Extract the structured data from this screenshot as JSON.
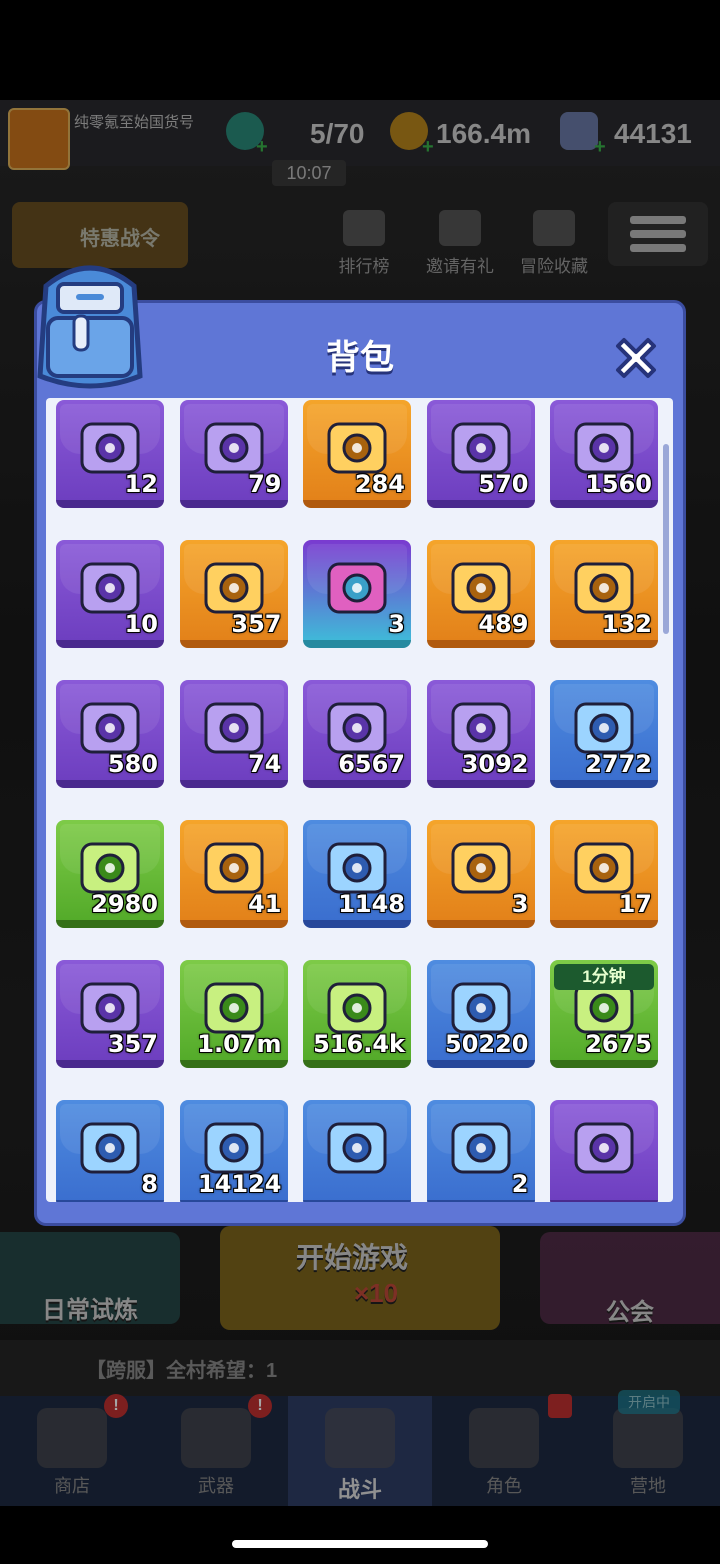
{
  "topbar": {
    "player_name": "纯零氪至始国货号",
    "stamina": "5/70",
    "gold": "166.4m",
    "gems": "44131",
    "timer": "10:07"
  },
  "top_actions": {
    "battle_pass": "特惠战令",
    "leaderboard": "排行榜",
    "invite": "邀请有礼",
    "collection": "冒险收藏"
  },
  "panel": {
    "title": "背包",
    "rows": [
      [
        {
          "icon": "green-ticket-icon",
          "rarity": "purple",
          "count": "12"
        },
        {
          "icon": "purple-gear-chest-icon",
          "rarity": "purple",
          "count": "79"
        },
        {
          "icon": "gold-ticket-icon",
          "rarity": "orange",
          "count": "284"
        },
        {
          "icon": "trophy-medal-icon",
          "rarity": "purple",
          "count": "570"
        },
        {
          "icon": "handshake-badge-icon",
          "rarity": "purple",
          "count": "1560"
        }
      ],
      [
        {
          "icon": "vortex-ticket-icon",
          "rarity": "purple",
          "count": "10"
        },
        {
          "icon": "robot-ticket-icon",
          "rarity": "orange",
          "count": "357"
        },
        {
          "icon": "vr-headset-icon",
          "rarity": "special",
          "count": "3"
        },
        {
          "icon": "cyan-screen-icon",
          "rarity": "orange",
          "count": "489"
        },
        {
          "icon": "gold-key-icon",
          "rarity": "orange",
          "count": "132"
        }
      ],
      [
        {
          "icon": "chip-tablet-icon",
          "rarity": "purple",
          "count": "580"
        },
        {
          "icon": "dark-dice-icon",
          "rarity": "purple",
          "count": "74"
        },
        {
          "icon": "purple-crystal-icon",
          "rarity": "purple",
          "count": "6567"
        },
        {
          "icon": "blue-card-icon",
          "rarity": "purple",
          "count": "3092"
        },
        {
          "icon": "blue-crystal-icon",
          "rarity": "blue",
          "count": "2772"
        }
      ],
      [
        {
          "icon": "green-gear-chest-icon",
          "rarity": "green",
          "count": "2980"
        },
        {
          "icon": "blue-arrow-triangle-icon",
          "rarity": "orange",
          "count": "41"
        },
        {
          "icon": "blue-gear-chest-icon",
          "rarity": "blue",
          "count": "1148"
        },
        {
          "icon": "gold-chest-icon",
          "rarity": "orange",
          "count": "3"
        },
        {
          "icon": "gold-arrow-coin-icon",
          "rarity": "orange",
          "count": "17"
        }
      ],
      [
        {
          "icon": "cyan-ticket-icon",
          "rarity": "purple",
          "count": "357"
        },
        {
          "icon": "energy-orb-icon",
          "rarity": "green",
          "count": "1.07m"
        },
        {
          "icon": "steel-beam-icon",
          "rarity": "green",
          "count": "516.4k"
        },
        {
          "icon": "sun-badge-icon",
          "rarity": "blue",
          "count": "50220"
        },
        {
          "icon": "fast-forward-icon",
          "rarity": "green",
          "count": "2675",
          "tag": "1分钟"
        }
      ],
      [
        {
          "icon": "hex-core-icon",
          "rarity": "blue",
          "count": "8"
        },
        {
          "icon": "chip-card-icon",
          "rarity": "blue",
          "count": "14124"
        },
        {
          "icon": "green-chevron-icon",
          "rarity": "blue",
          "count": ""
        },
        {
          "icon": "x4-badge-icon",
          "rarity": "blue",
          "count": "2"
        },
        {
          "icon": "purple-emblem-icon",
          "rarity": "purple",
          "count": ""
        }
      ]
    ]
  },
  "bottom": {
    "daily": "日常试炼",
    "start": "开始游戏",
    "start_cost": "×10",
    "guild": "公会",
    "broadcast": "【跨服】全村希望：1"
  },
  "nav": {
    "shop": "商店",
    "weapons": "武器",
    "battle": "战斗",
    "character": "角色",
    "camp": "营地",
    "open_tag": "开启中"
  },
  "colors": {
    "panel": "#5f76d6",
    "purple": "#7a4ad0",
    "orange": "#f09a25",
    "blue": "#437ed8",
    "green": "#6abc38"
  }
}
